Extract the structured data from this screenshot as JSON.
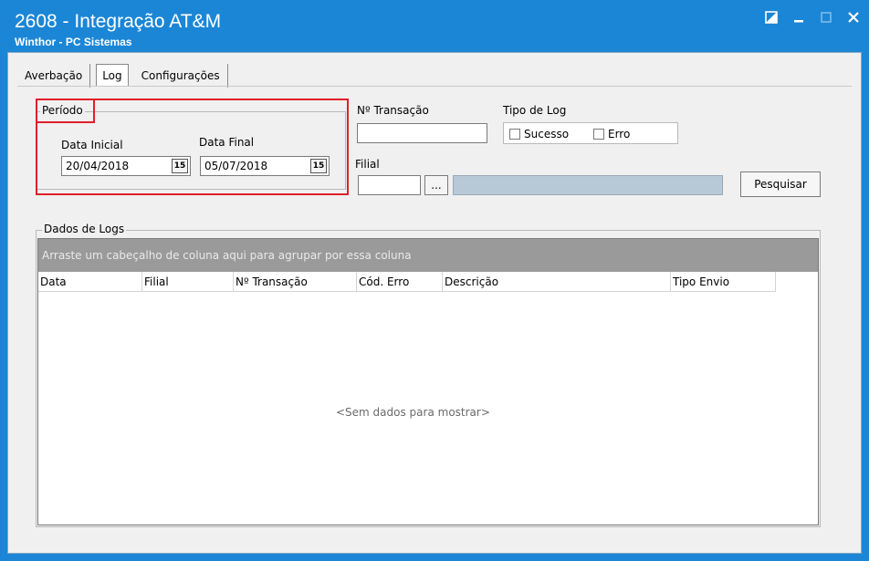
{
  "window": {
    "title": "2608 - Integração AT&M",
    "subtitle": "Winthor - PC Sistemas"
  },
  "tabs": [
    {
      "label": "Averbação"
    },
    {
      "label": "Log"
    },
    {
      "label": "Configurações"
    }
  ],
  "periodo": {
    "legend": "Período",
    "data_inicial_label": "Data Inicial",
    "data_inicial_value": "20/04/2018",
    "data_final_label": "Data Final",
    "data_final_value": "05/07/2018",
    "calendar_glyph": "15"
  },
  "transacao": {
    "label": "Nº Transação",
    "value": ""
  },
  "tipo_log": {
    "label": "Tipo de Log",
    "options": [
      {
        "label": "Sucesso",
        "checked": false
      },
      {
        "label": "Erro",
        "checked": false
      }
    ]
  },
  "filial": {
    "label": "Filial",
    "value": "",
    "browse_label": "...",
    "description": ""
  },
  "pesquisar_label": "Pesquisar",
  "logs": {
    "legend": "Dados de Logs",
    "group_hint": "Arraste um cabeçalho de coluna aqui para agrupar por essa coluna",
    "columns": [
      "Data",
      "Filial",
      "Nº Transação",
      "Cód. Erro",
      "Descrição",
      "Tipo Envio"
    ],
    "empty_message": "<Sem dados para mostrar>"
  }
}
